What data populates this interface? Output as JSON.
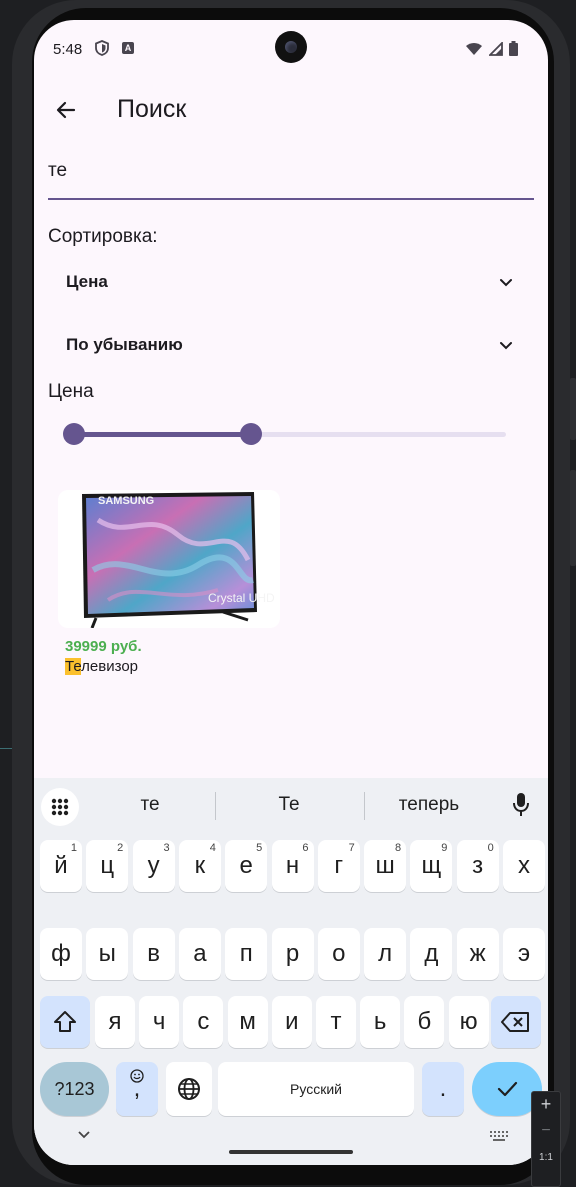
{
  "status_bar": {
    "time": "5:48"
  },
  "appbar": {
    "title": "Поиск"
  },
  "search": {
    "value": "те"
  },
  "sort": {
    "label": "Сортировка:",
    "field_value": "Цена",
    "order_value": "По убыванию"
  },
  "price_filter": {
    "label": "Цена",
    "range_low_fraction": 0.0,
    "range_high_fraction": 0.41
  },
  "product": {
    "price": "39999 руб.",
    "name_highlight": "Те",
    "name_rest": "левизор",
    "image_brand": "SAMSUNG",
    "image_caption": "Crystal UHD"
  },
  "keyboard": {
    "suggestions": [
      "те",
      "Те",
      "теперь"
    ],
    "row1": [
      {
        "k": "й",
        "h": "1"
      },
      {
        "k": "ц",
        "h": "2"
      },
      {
        "k": "у",
        "h": "3"
      },
      {
        "k": "к",
        "h": "4"
      },
      {
        "k": "е",
        "h": "5"
      },
      {
        "k": "н",
        "h": "6"
      },
      {
        "k": "г",
        "h": "7"
      },
      {
        "k": "ш",
        "h": "8"
      },
      {
        "k": "щ",
        "h": "9"
      },
      {
        "k": "з",
        "h": "0"
      },
      {
        "k": "х",
        "h": ""
      }
    ],
    "row2": [
      "ф",
      "ы",
      "в",
      "а",
      "п",
      "р",
      "о",
      "л",
      "д",
      "ж",
      "э"
    ],
    "row3": [
      "я",
      "ч",
      "с",
      "м",
      "и",
      "т",
      "ь",
      "б",
      "ю"
    ],
    "sym_label": "?123",
    "comma_label": ",",
    "space_label": "Русский",
    "period_label": "."
  },
  "colors": {
    "accent": "#65558f",
    "price_green": "#4caf50",
    "highlight": "#fbc02d",
    "screen_bg": "#fdf7fd",
    "keyboard_bg": "#eef0f4"
  },
  "icons": [
    "back-arrow-icon",
    "shield-icon",
    "a-icon",
    "wifi-icon",
    "signal-icon",
    "battery-icon",
    "chevron-down-icon",
    "grid-icon",
    "mic-icon",
    "shift-icon",
    "backspace-icon",
    "emoji-icon",
    "globe-icon",
    "check-icon",
    "keyboard-hide-icon",
    "keyboard-icon"
  ]
}
